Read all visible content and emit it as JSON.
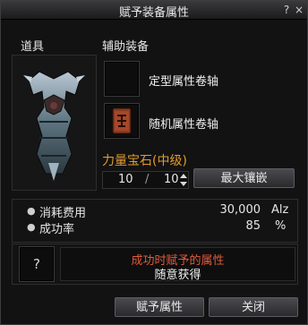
{
  "window": {
    "title": "赋予装备属性",
    "help_glyph": "?",
    "close_glyph": "×"
  },
  "labels": {
    "item": "道具",
    "aux_equipment": "辅助装备"
  },
  "aux_slots": [
    {
      "label": "定型属性卷轴"
    },
    {
      "label": "随机属性卷轴"
    }
  ],
  "gem": {
    "name": "力量宝石(中级)",
    "current": "10",
    "separator": "/",
    "max": "10",
    "max_button": "最大镶嵌"
  },
  "cost": {
    "label": "消耗费用",
    "value": "30,000",
    "unit": "Alz"
  },
  "success": {
    "label": "成功率",
    "value": "85",
    "unit": "%"
  },
  "result": {
    "question_glyph": "?",
    "line1": "成功时赋予的属性",
    "line2": "随意获得"
  },
  "buttons": {
    "apply": "赋予属性",
    "close": "关闭"
  },
  "icons": {
    "help": "help-icon",
    "close": "close-icon",
    "armor": "armor-icon",
    "scroll": "scroll-icon",
    "spin_up": "triangle-up-icon",
    "spin_down": "triangle-down-icon",
    "bullet": "bullet-dot-icon"
  }
}
